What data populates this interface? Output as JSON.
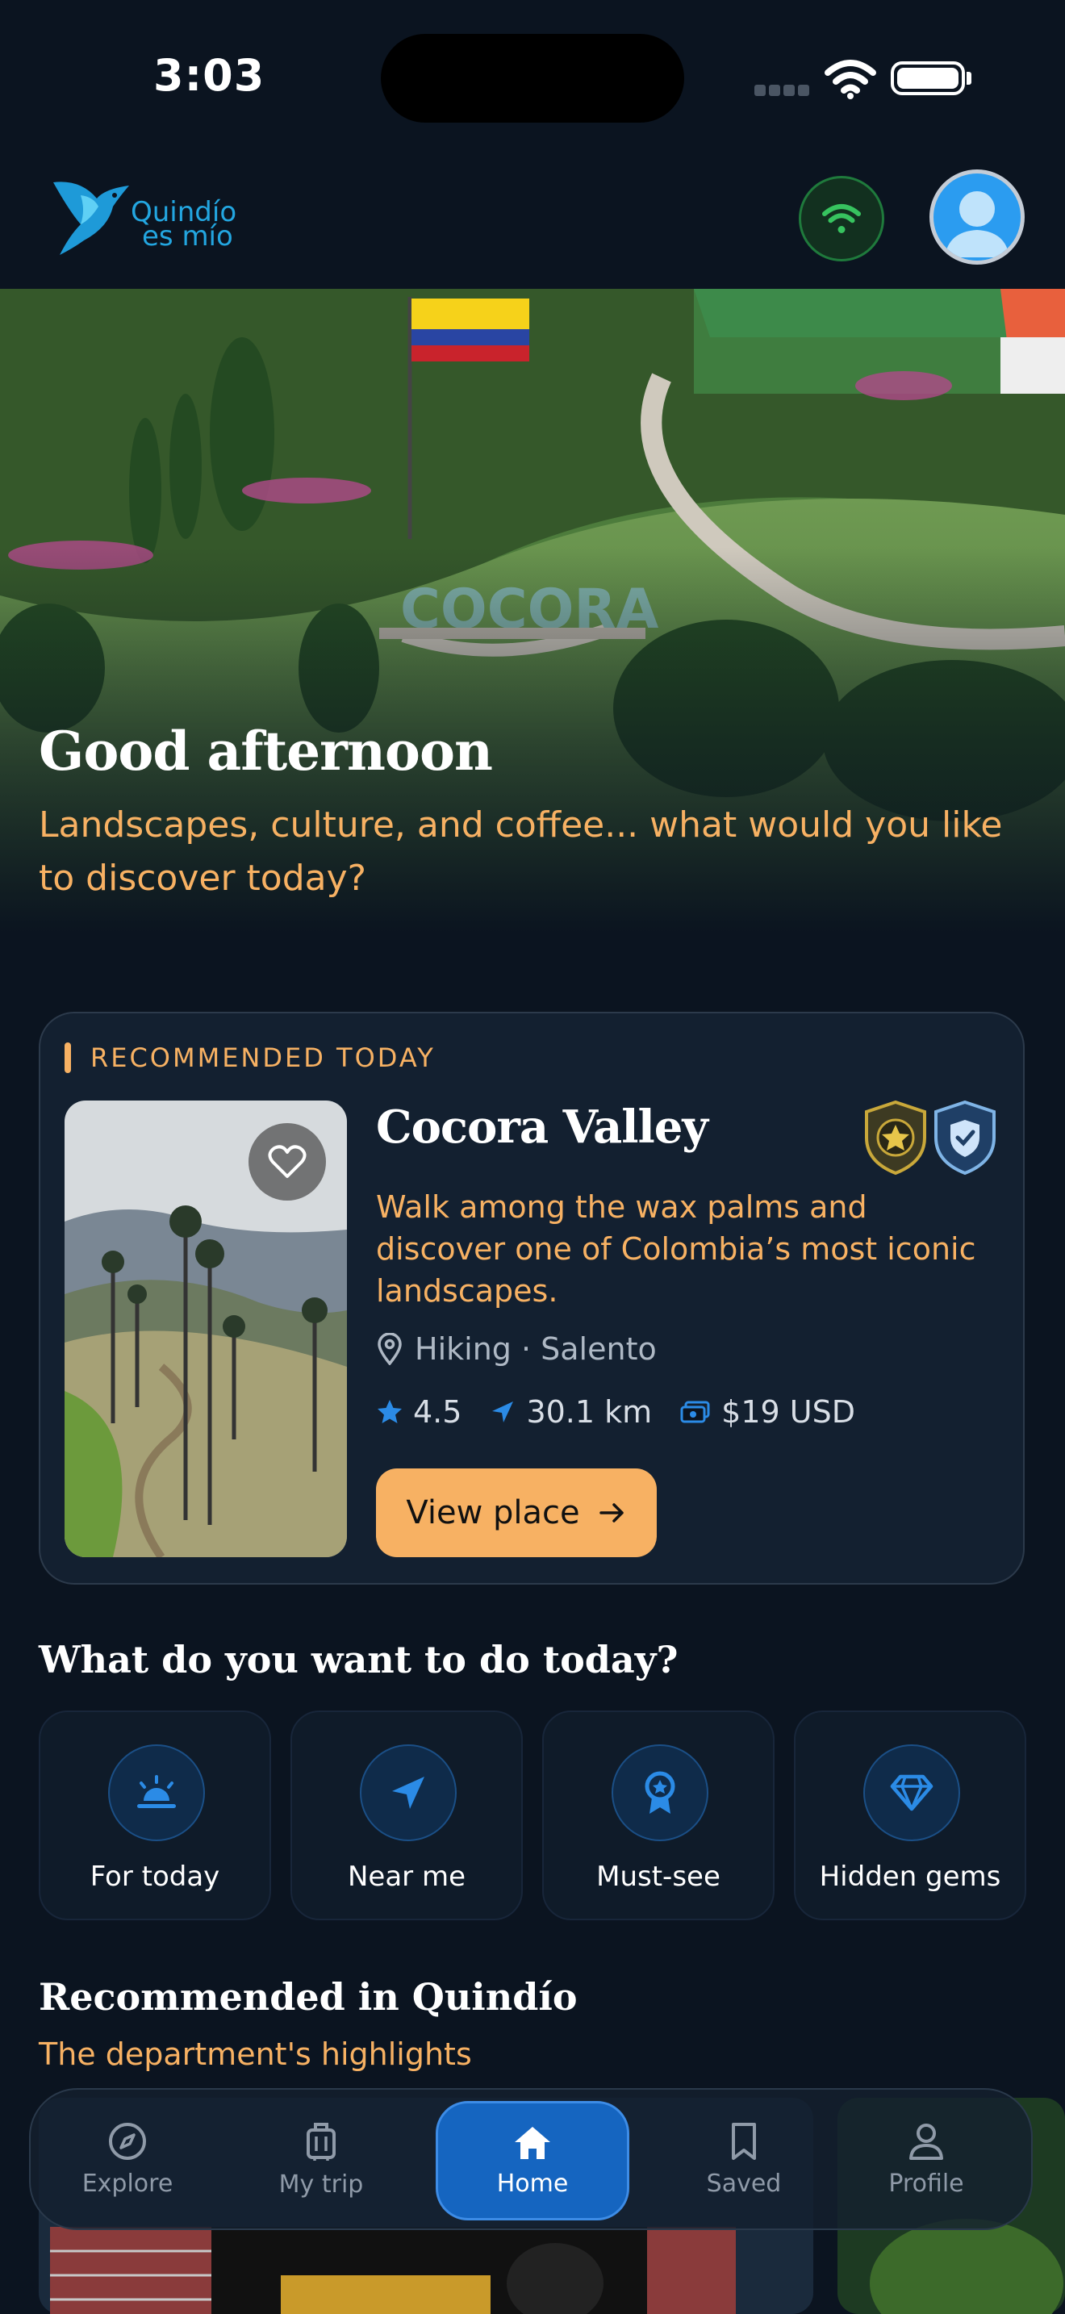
{
  "status_bar": {
    "time": "3:03"
  },
  "header": {
    "logo_line1": "Quindío",
    "logo_line2": "es mío"
  },
  "hero": {
    "greeting": "Good afternoon",
    "subtitle": "Landscapes, culture, and coffee... what would you like to discover today?"
  },
  "recommended_today": {
    "label": "RECOMMENDED TODAY",
    "title": "Cocora Valley",
    "description": "Walk among the wax palms and discover one of Colombia’s most iconic landscapes.",
    "category": "Hiking · Salento",
    "rating": "4.5",
    "distance": "30.1 km",
    "price": "$19 USD",
    "cta": "View place"
  },
  "quick_actions": {
    "title": "What do you want to do today?",
    "items": [
      {
        "label": "For today",
        "icon": "sunrise-icon"
      },
      {
        "label": "Near me",
        "icon": "navigation-arrow-icon"
      },
      {
        "label": "Must-see",
        "icon": "award-ribbon-icon"
      },
      {
        "label": "Hidden gems",
        "icon": "diamond-icon"
      }
    ]
  },
  "recommended_quindio": {
    "title": "Recommended in Quindío",
    "subtitle": "The department's highlights"
  },
  "bottom_nav": {
    "items": [
      {
        "label": "Explore",
        "icon": "compass-icon"
      },
      {
        "label": "My trip",
        "icon": "luggage-icon"
      },
      {
        "label": "Home",
        "icon": "home-icon",
        "active": true
      },
      {
        "label": "Saved",
        "icon": "bookmark-icon"
      },
      {
        "label": "Profile",
        "icon": "user-icon"
      }
    ]
  },
  "colors": {
    "background": "#0b1420",
    "accent_orange": "#f7b163",
    "accent_blue": "#1565c0",
    "card": "#132030"
  }
}
